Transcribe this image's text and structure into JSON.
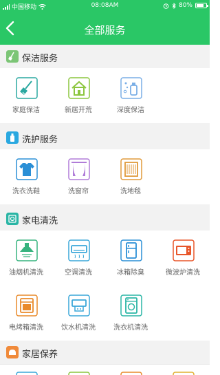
{
  "status": {
    "carrier": "中国移动",
    "time": "08:08AM",
    "battery": "80%",
    "battery_level": 0.8
  },
  "nav": {
    "title": "全部服务"
  },
  "sections": [
    {
      "title": "保洁服务",
      "color": "#7cc576",
      "items": [
        {
          "label": "家庭保洁",
          "icon": "broom-icon",
          "color": "#2aa8a0"
        },
        {
          "label": "新居开荒",
          "icon": "house-icon",
          "color": "#8cc63f"
        },
        {
          "label": "深度保洁",
          "icon": "spray-bottle-icon",
          "color": "#7aaee6"
        }
      ]
    },
    {
      "title": "洗护服务",
      "color": "#29a8e0",
      "items": [
        {
          "label": "洗衣洗鞋",
          "icon": "tshirt-icon",
          "color": "#2a8fd6"
        },
        {
          "label": "洗窗帘",
          "icon": "curtain-icon",
          "color": "#b07cd8"
        },
        {
          "label": "洗地毯",
          "icon": "carpet-icon",
          "color": "#e09a3a"
        }
      ]
    },
    {
      "title": "家电清洗",
      "color": "#2ab5a5",
      "items": [
        {
          "label": "油烟机清洗",
          "icon": "range-hood-icon",
          "color": "#36b37e"
        },
        {
          "label": "空调清洗",
          "icon": "air-conditioner-icon",
          "color": "#3aa7d9"
        },
        {
          "label": "冰箱除臭",
          "icon": "fridge-icon",
          "color": "#2a8fd6"
        },
        {
          "label": "微波炉清洗",
          "icon": "microwave-icon",
          "color": "#e8562a"
        },
        {
          "label": "电烤箱清洗",
          "icon": "oven-icon",
          "color": "#e98a2a"
        },
        {
          "label": "饮水机清洗",
          "icon": "water-dispenser-icon",
          "color": "#3aa7d9"
        },
        {
          "label": "洗衣机清洗",
          "icon": "washing-machine-icon",
          "color": "#2ab5a5"
        }
      ]
    },
    {
      "title": "家居保养",
      "color": "#f08a3a",
      "items": []
    }
  ]
}
